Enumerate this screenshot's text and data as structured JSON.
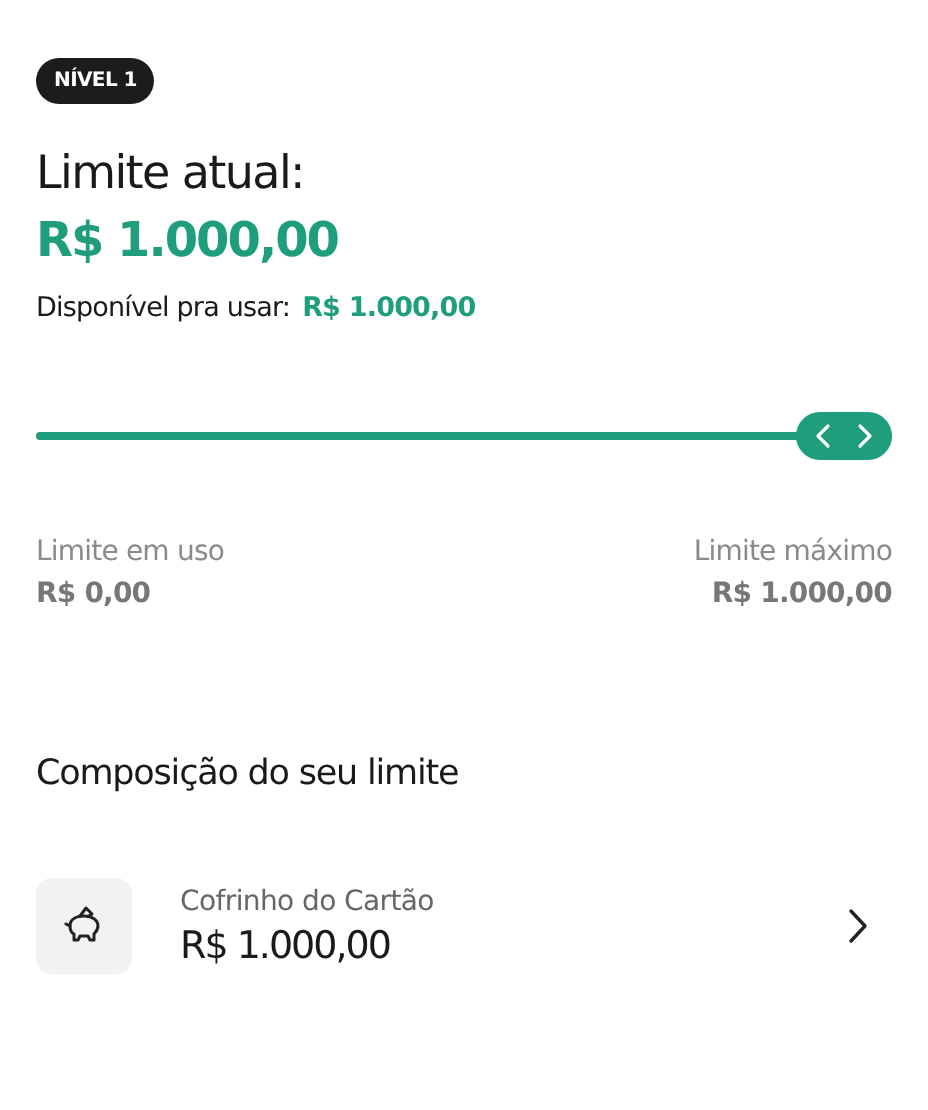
{
  "badge": "NÍVEL 1",
  "title": "Limite atual:",
  "amount": "R$ 1.000,00",
  "available": {
    "label": "Disponível pra usar:",
    "value": "R$ 1.000,00"
  },
  "slider": {
    "level": 1
  },
  "limits": [
    {
      "label": "Limite em uso",
      "value": "R$ 0,00"
    },
    {
      "label": "Limite máximo",
      "value": "R$ 1.000,00"
    }
  ],
  "section_title": "Composição do seu limite",
  "items": [
    {
      "name": "Cofrinho do Cartão",
      "value": "R$ 1.000,00"
    }
  ]
}
